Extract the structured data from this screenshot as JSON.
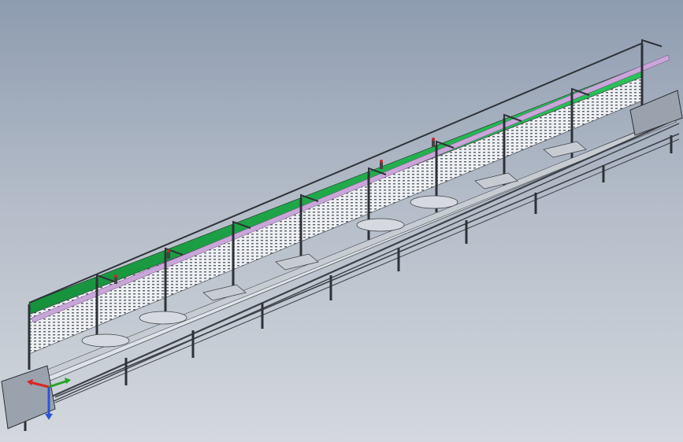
{
  "window": {
    "title": ""
  },
  "scene": {
    "model": "assembly-line-conveyor",
    "colors": {
      "background_top": "#8e9cb0",
      "background_bottom": "#d4d8de",
      "frame": "#3d4148",
      "panel_green": "#22b14c",
      "rail_top": "#c9a6d8",
      "workstation_panel": "#e8eaee",
      "conveyor": "#6b7280",
      "fixture_plate": "#c7ccd3"
    },
    "icons": {
      "triad": "coordinate-axes-triad-icon",
      "lamp": "signal-lamp-icon"
    }
  },
  "triad": {
    "x_color": "#d92626",
    "y_color": "#27a327",
    "z_color": "#2a55d6"
  }
}
